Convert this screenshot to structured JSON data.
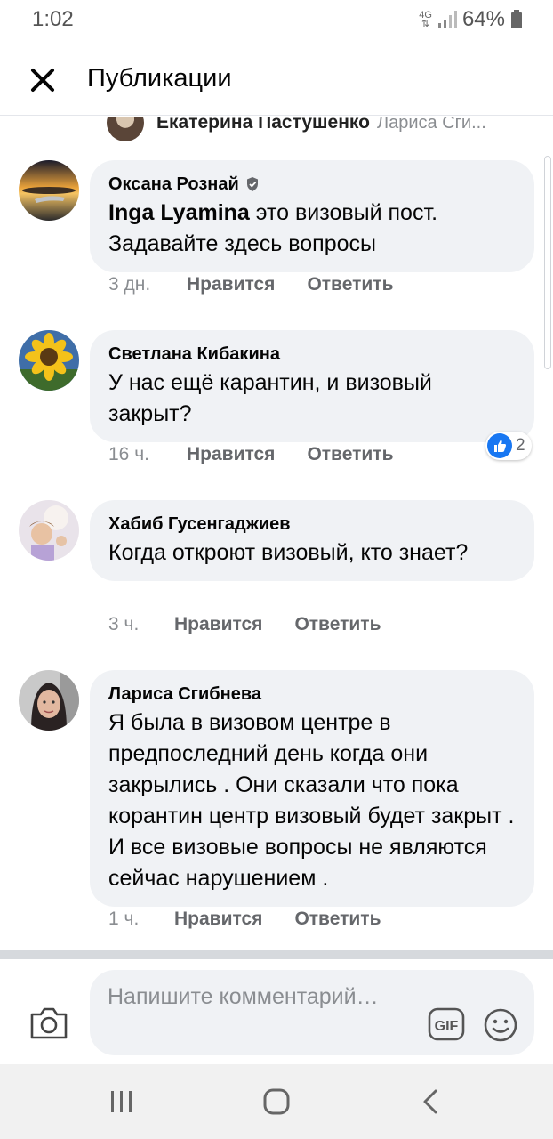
{
  "status_bar": {
    "time": "1:02",
    "network": "4G",
    "battery": "64%"
  },
  "header": {
    "title": "Публикации",
    "close_icon": "close-icon"
  },
  "partial_comment": {
    "author": "Екатерина Пастушенко",
    "tag": "Лариса Сги..."
  },
  "comments": [
    {
      "author": "Оксана Рознай",
      "verified": true,
      "mention": "Inga Lyamina",
      "text": " это визовый пост. Задавайте здесь вопросы",
      "time": "3 дн.",
      "like": "Нравится",
      "reply": "Ответить"
    },
    {
      "author": "Светлана Кибакина",
      "text": "У нас ещё карантин, и визовый закрыт?",
      "time": "16 ч.",
      "like": "Нравится",
      "reply": "Ответить",
      "reaction_count": "2"
    },
    {
      "author": "Хабиб Гусенгаджиев",
      "text": "Когда откроют визовый, кто знает?",
      "time": "3 ч.",
      "like": "Нравится",
      "reply": "Ответить"
    },
    {
      "author": "Лариса Сгибнева",
      "text": "Я была в визовом центре в предпоследний день когда они закрылись . Они сказали что пока корантин центр визовый будет закрыт . И все визовые вопросы не являются сейчас нарушением .",
      "time": "1 ч.",
      "like": "Нравится",
      "reply": "Ответить"
    }
  ],
  "composer": {
    "placeholder": "Напишите комментарий…",
    "gif_label": "GIF"
  },
  "colors": {
    "accent": "#1877f2",
    "bubble": "#f0f2f5",
    "meta": "#65676b"
  }
}
